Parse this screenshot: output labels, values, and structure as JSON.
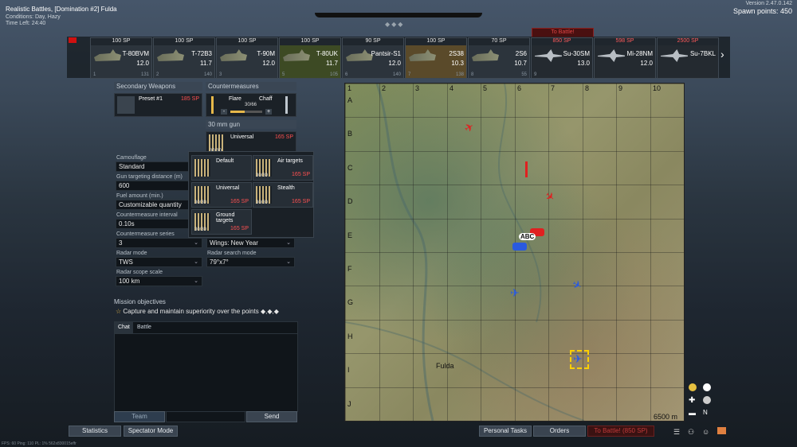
{
  "header": {
    "mode": "Realistic Battles, [Domination #2] Fulda",
    "conditions": "Conditions: Day, Hazy",
    "time_left": "Time Left: 24:40",
    "version": "Version 2.47.0.142",
    "spawn_points": "Spawn points: 450",
    "to_battle": "To Battle!"
  },
  "vehicles": [
    {
      "cost": "100 SP",
      "count": "1",
      "name": "T-80BVM",
      "br": "12.0",
      "num": "1",
      "rep": "131",
      "type": "ground",
      "state": "normal",
      "cost_red": false
    },
    {
      "cost": "100 SP",
      "count": "1",
      "name": "T-72B3",
      "br": "11.7",
      "num": "2",
      "rep": "140",
      "type": "ground",
      "state": "normal",
      "cost_red": false
    },
    {
      "cost": "100 SP",
      "count": "",
      "name": "T-90M",
      "br": "12.0",
      "num": "3",
      "rep": "",
      "type": "ground",
      "state": "normal",
      "cost_red": false
    },
    {
      "cost": "100 SP",
      "count": "",
      "name": "T-80UK",
      "br": "11.7",
      "num": "5",
      "rep": "105",
      "type": "ground",
      "state": "sel",
      "cost_red": false
    },
    {
      "cost": "90 SP",
      "count": "8",
      "name": "Pantsir-S1",
      "br": "12.0",
      "num": "6",
      "rep": "140",
      "type": "ground",
      "state": "normal",
      "cost_red": false
    },
    {
      "cost": "100 SP",
      "count": "2",
      "name": "2S38",
      "br": "10.3",
      "num": "7",
      "rep": "138",
      "type": "ground",
      "state": "dmg",
      "cost_red": false
    },
    {
      "cost": "70 SP",
      "count": "5",
      "name": "2S6",
      "br": "10.7",
      "num": "8",
      "rep": "55",
      "type": "ground",
      "state": "normal",
      "cost_red": false
    },
    {
      "cost": "850 SP",
      "count": "",
      "name": "Su-30SM",
      "br": "13.0",
      "num": "9",
      "rep": "",
      "type": "air",
      "state": "locked",
      "cost_red": true
    },
    {
      "cost": "598 SP",
      "count": "",
      "name": "Mi-28NM",
      "br": "12.0",
      "num": "",
      "rep": "",
      "type": "air",
      "state": "locked",
      "cost_red": true
    },
    {
      "cost": "2500 SP",
      "count": "",
      "name": "Su-7BKL",
      "br": "",
      "num": "",
      "rep": "",
      "type": "air",
      "state": "locked",
      "cost_red": true
    }
  ],
  "secondary": {
    "head": "Secondary Weapons",
    "preset": "Preset #1",
    "price": "185 SP"
  },
  "countermeasures": {
    "head": "Countermeasures",
    "flare": "Flare",
    "chaff": "Chaff",
    "ratio": "30/66",
    "minus": "-",
    "plus": "+"
  },
  "gun": {
    "head": "30 mm gun",
    "belt": "Universal",
    "price": "165 SP",
    "count": "30/30"
  },
  "ammo_options": [
    {
      "label": "Default",
      "price": "",
      "count": ""
    },
    {
      "label": "Air targets",
      "price": "165 SP",
      "count": "30/30"
    },
    {
      "label": "Universal",
      "price": "165 SP",
      "count": "30/30"
    },
    {
      "label": "Stealth",
      "price": "165 SP",
      "count": "30/30"
    },
    {
      "label": "Ground targets",
      "price": "165 SP",
      "count": "30/30"
    }
  ],
  "settings": {
    "camouflage_label": "Camouflage",
    "camouflage": "Standard",
    "gun_dist_label": "Gun targeting distance (m)",
    "gun_dist": "600",
    "fuel_label": "Fuel amount (min.)",
    "fuel": "Customizable quantity",
    "cm_interval_label": "Countermeasure interval",
    "cm_interval": "0.10s",
    "cm_series_label": "Countermeasure series",
    "cm_series": "3",
    "wings": "Wings: New Year",
    "radar_mode_label": "Radar mode",
    "radar_mode": "TWS",
    "radar_search_label": "Radar search mode",
    "radar_search": "79°x7°",
    "radar_scope_label": "Radar scope scale",
    "radar_scope": "100 km"
  },
  "mission": {
    "head": "Mission objectives",
    "text": "Capture and maintain superiority over the points ◆,◆,◆"
  },
  "chat": {
    "tab_chat": "Chat",
    "tab_battle": "Battle",
    "team": "Team",
    "send": "Send"
  },
  "map": {
    "cols": [
      "1",
      "2",
      "3",
      "4",
      "5",
      "6",
      "7",
      "8",
      "9",
      "10"
    ],
    "rows": [
      "A",
      "B",
      "C",
      "D",
      "E",
      "F",
      "G",
      "H",
      "I",
      "J"
    ],
    "scale": "6500 m",
    "city": "Fulda"
  },
  "bottom": {
    "statistics": "Statistics",
    "spectator": "Spectator Mode",
    "tasks": "Personal Tasks",
    "orders": "Orders",
    "to_battle": "To Battle! (850 SP)",
    "status": "FPS: 60   Ping: 110   PL: 1%   562x830015effr"
  },
  "colors": {
    "enemy": "#e02020",
    "ally": "#2a5ae0",
    "accent_red": "#ff5050"
  }
}
